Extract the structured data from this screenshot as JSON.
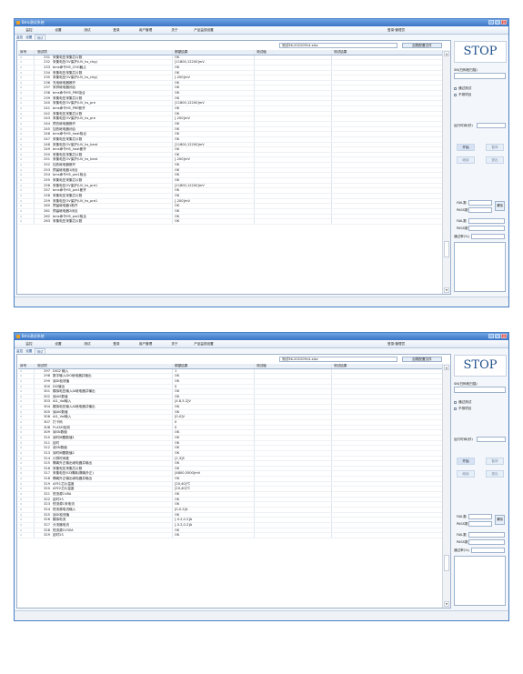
{
  "windows": [
    {
      "title": "Bms测试系统",
      "menu": [
        "监控",
        "设置",
        "测试",
        "登录",
        "用户管理",
        "关于",
        "产品监视设置"
      ],
      "user_label": "登录:管理员",
      "tabs": [
        "监控",
        "设置",
        "测试"
      ],
      "active_tab": "测试",
      "file_path": "测试36-20220914.xlsx",
      "load_button": "加载配置文件",
      "columns": [
        "序号",
        "测试项",
        "期望结果",
        "测试值",
        "测试结果"
      ],
      "rows": [
        [
          "231",
          "采集电压采集芯片数",
          "OK"
        ],
        [
          "232",
          "采集电压OV保护(UV_hs_chg)",
          "[11800,12200]mV"
        ],
        [
          "233",
          "bms命令H5_CHG截止",
          "OK"
        ],
        [
          "234",
          "采集电压采集芯片数",
          "OK"
        ],
        [
          "235",
          "采集电压OV保护(UV_hs_chg)",
          "[-200]mV"
        ],
        [
          "236",
          "充电继电器断开",
          "OK"
        ],
        [
          "237",
          "采样继电器闭合",
          "OK"
        ],
        [
          "238",
          "bms命令H5_PRE吸合",
          "OK"
        ],
        [
          "239",
          "采集电压采集芯片数",
          "OK"
        ],
        [
          "240",
          "采集电压OV保护(UV_hs_pre",
          "[11800,12200]mV"
        ],
        [
          "241",
          "bms命令H5_PRE断开",
          "OK"
        ],
        [
          "242",
          "采集电压采集芯片数",
          "OK"
        ],
        [
          "243",
          "采集电压OV保护(UV_hs_pre",
          "[-200]mV"
        ],
        [
          "244",
          "预充继电器断开",
          "OK"
        ],
        [
          "245",
          "加热继电器闭合",
          "OK"
        ],
        [
          "246",
          "bms命令H5_heat吸合",
          "OK"
        ],
        [
          "247",
          "采集电压采集芯片数",
          "OK"
        ],
        [
          "248",
          "采集电压OV保护(UV_hs_heat",
          "[11800,12200]mV"
        ],
        [
          "249",
          "bms命令H5_heat断开",
          "OK"
        ],
        [
          "250",
          "采集电压采集芯片数",
          "OK"
        ],
        [
          "251",
          "采集电压OV保护(UV_hs_heat",
          "[-200]mV"
        ],
        [
          "252",
          "加热继电器断开",
          "OK"
        ],
        [
          "253",
          "预留继电器1闭合",
          "OK"
        ],
        [
          "254",
          "bms命令H5_pre1吸合",
          "OK"
        ],
        [
          "255",
          "采集电压采集芯片数",
          "OK"
        ],
        [
          "256",
          "采集电压OV保护(UV_hs_pre1",
          "[11800,12200]mV"
        ],
        [
          "257",
          "bms命令H5_pre1断开",
          "OK"
        ],
        [
          "258",
          "采集电压采集芯片数",
          "OK"
        ],
        [
          "259",
          "采集电压OV保护(UV_hs_pre1",
          "[-200]mV"
        ],
        [
          "260",
          "预留继电器1断开",
          "OK"
        ],
        [
          "261",
          "预留继电器2闭合",
          "OK"
        ],
        [
          "262",
          "bms命令H5_pre2吸合",
          "OK"
        ],
        [
          "263",
          "采集电压采集芯片数",
          "OK"
        ]
      ],
      "scroll_up": "▲",
      "scroll_down": "▼",
      "scroll_position": 0.86,
      "side": {
        "stop": "STOP",
        "sn_label": "SN(扫码枪扫描)",
        "checkboxes": [
          "通过测试",
          "不测项目"
        ],
        "runtime_label": "运行时间(秒)",
        "start": "开始",
        "pause": "暂停",
        "resume": "继续",
        "exit": "退出",
        "fail_count": "FAIL数",
        "pass_count": "PASS数",
        "clear": "清除",
        "fail_label": "FAIL数",
        "pass_label": "PASS数",
        "pass_rate": "通过率(%)"
      }
    },
    {
      "title": "Bms测试系统",
      "menu": [
        "监控",
        "设置",
        "测试",
        "登录",
        "用户管理",
        "关于",
        "产品监视设置"
      ],
      "user_label": "登录:管理员",
      "tabs": [
        "监控",
        "设置",
        "测试"
      ],
      "active_tab": "测试",
      "file_path": "测试36-20220914.xlsx",
      "load_button": "加载配置文件",
      "columns": [
        "序号",
        "测试项",
        "期望结果",
        "测试值",
        "测试结果"
      ],
      "rows": [
        [
          "297",
          "DIG2 输入",
          "1"
        ],
        [
          "298",
          "数字输入DIO继电器并输出",
          "OK"
        ],
        [
          "299",
          "读DI检测值",
          "OK"
        ],
        [
          "300",
          "DI2输出",
          "0"
        ],
        [
          "301",
          "模拟电压输入AI继电器并输出",
          "OK"
        ],
        [
          "302",
          "读AI0数值",
          "OK"
        ],
        [
          "303",
          "AI1_Vol输入",
          "[4.8,5.2]V"
        ],
        [
          "304",
          "模拟电压输入AI继电器并输出",
          "OK"
        ],
        [
          "305",
          "读AI0数值",
          "OK"
        ],
        [
          "306",
          "AI1_Vol输入",
          "[0,0]V"
        ],
        [
          "307",
          "打卡码",
          "0"
        ],
        [
          "308",
          "FLASH检测",
          "0"
        ],
        [
          "309",
          "读SN数值",
          "OK"
        ],
        [
          "310",
          "读时间戳数值1",
          "OK"
        ],
        [
          "311",
          "延时",
          "OK"
        ],
        [
          "312",
          "读SN数值",
          "OK"
        ],
        [
          "313",
          "读时间戳数值2",
          "OK"
        ],
        [
          "314",
          "计算时间差",
          "[1,3]S"
        ],
        [
          "315",
          "隔离外正输出继电器并输出",
          "OK"
        ],
        [
          "316",
          "采集电压采集芯片数",
          "OK"
        ],
        [
          "317",
          "采集电压ISO隔离(隔离外正)",
          "[4800,5500]mV"
        ],
        [
          "318",
          "隔离外正输出继电器并输出",
          "OK"
        ],
        [
          "319",
          "AFE1芯片温度",
          "[20,40]℃"
        ],
        [
          "320",
          "AFE2芯片温度",
          "[20,40]℃"
        ],
        [
          "321",
          "恒流源1V8A",
          "OK"
        ],
        [
          "322",
          "延时2S",
          "OK"
        ],
        [
          "323",
          "恒流源1采电流",
          "OK"
        ],
        [
          "324",
          "恒流源电流输入",
          "[0,0.2]A"
        ],
        [
          "325",
          "读DI检测值",
          "OK"
        ],
        [
          "326",
          "模拟电流",
          "[-0.2,0.2]A"
        ],
        [
          "327",
          "分流器电流",
          "[-0.2,0.2]A"
        ],
        [
          "328",
          "恒流源1V30A",
          "OK"
        ],
        [
          "329",
          "延时2S",
          "OK"
        ]
      ],
      "scroll_up": "▲",
      "scroll_down": "▼",
      "scroll_position": 0.86,
      "side": {
        "stop": "STOP",
        "sn_label": "SN(扫码枪扫描)",
        "checkboxes": [
          "通过测试",
          "不测项目"
        ],
        "runtime_label": "运行时间(秒)",
        "start": "开始",
        "pause": "暂停",
        "resume": "继续",
        "exit": "退出",
        "fail_count": "FAIL数",
        "pass_count": "PASS数",
        "clear": "清除",
        "fail_label": "FAIL数",
        "pass_label": "PASS数",
        "pass_rate": "通过率(%)"
      }
    }
  ]
}
